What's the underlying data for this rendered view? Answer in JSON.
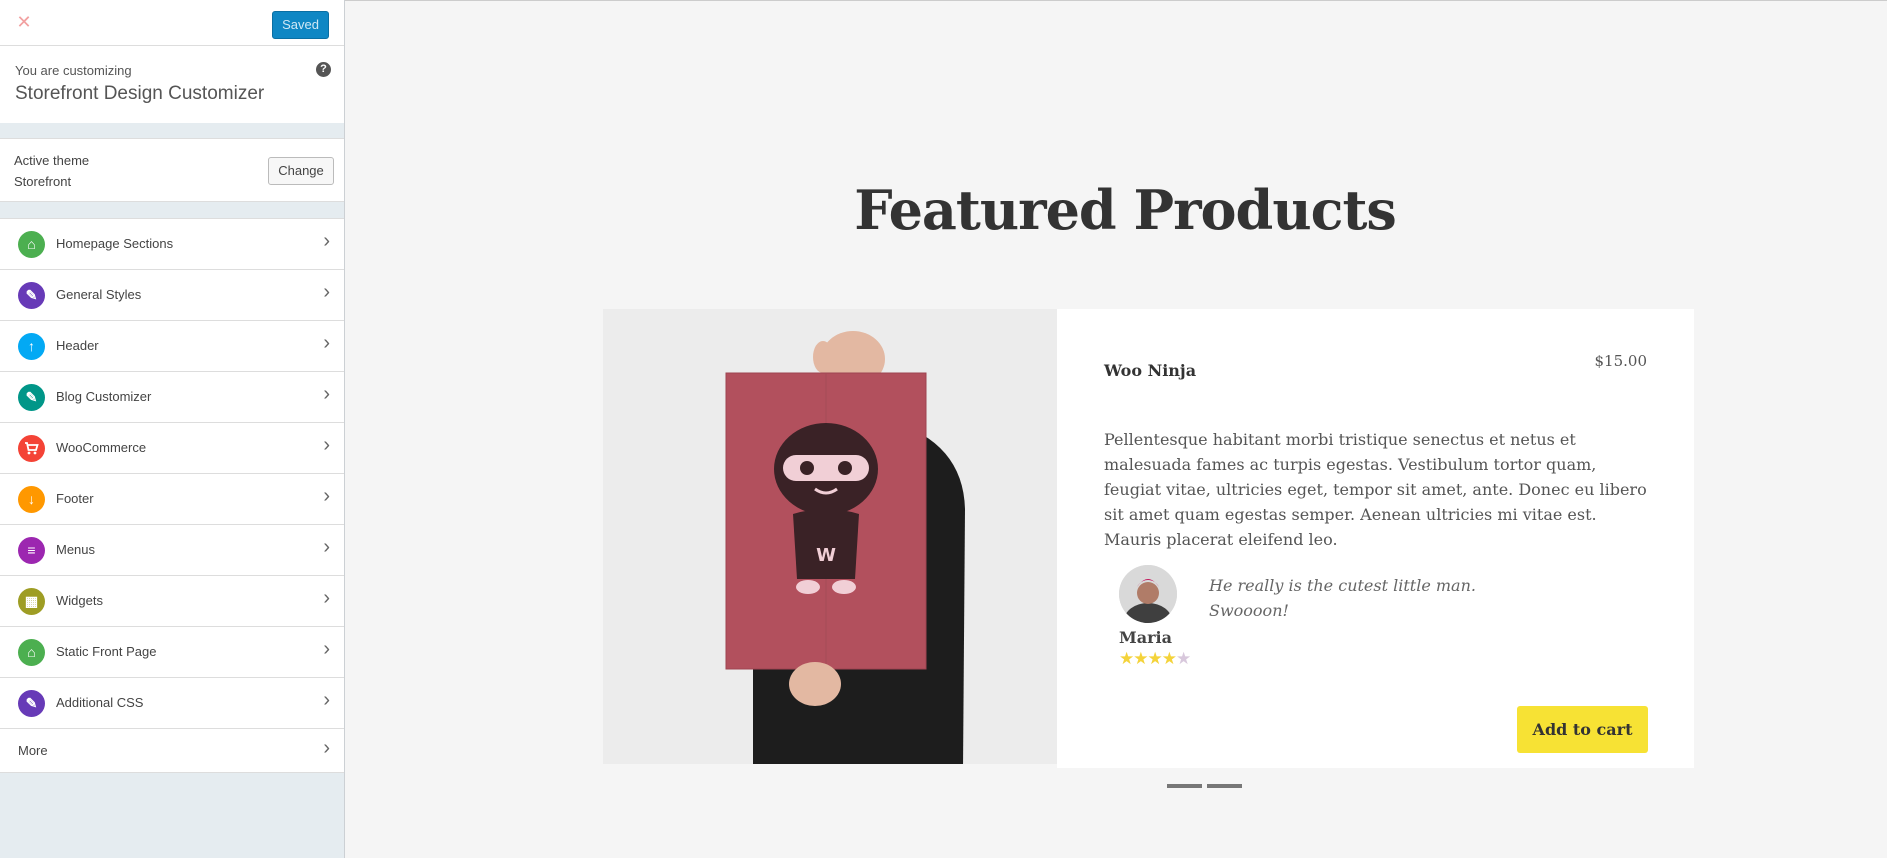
{
  "sidebar": {
    "close_glyph": "✕",
    "saved_label": "Saved",
    "customizing_label": "You are customizing",
    "customizing_title": "Storefront Design Customizer",
    "help_glyph": "?",
    "active_theme_label": "Active theme",
    "active_theme_name": "Storefront",
    "change_label": "Change",
    "items": [
      {
        "label": "Homepage Sections",
        "icon": "home-icon",
        "glyph": "⌂",
        "color": "#4caf50"
      },
      {
        "label": "General Styles",
        "icon": "paintbrush-icon",
        "glyph": "✎",
        "color": "#673ab7"
      },
      {
        "label": "Header",
        "icon": "arrow-up-icon",
        "glyph": "↑",
        "color": "#03a9f4"
      },
      {
        "label": "Blog Customizer",
        "icon": "pencil-icon",
        "glyph": "✎",
        "color": "#009688"
      },
      {
        "label": "WooCommerce",
        "icon": "cart-icon",
        "glyph": "🛒",
        "color": "#f44336"
      },
      {
        "label": "Footer",
        "icon": "arrow-down-icon",
        "glyph": "↓",
        "color": "#ff9800"
      },
      {
        "label": "Menus",
        "icon": "menu-icon",
        "glyph": "≡",
        "color": "#9c27b0"
      },
      {
        "label": "Widgets",
        "icon": "widgets-icon",
        "glyph": "▦",
        "color": "#9e9d24"
      },
      {
        "label": "Static Front Page",
        "icon": "home-icon",
        "glyph": "⌂",
        "color": "#4caf50"
      },
      {
        "label": "Additional CSS",
        "icon": "paintbrush-icon",
        "glyph": "✎",
        "color": "#673ab7"
      }
    ],
    "more_label": "More",
    "chevron_glyph": "›"
  },
  "preview": {
    "heading": "Featured Products",
    "product": {
      "name": "Woo Ninja",
      "price": "$15.00",
      "description": "Pellentesque habitant morbi tristique senectus et netus et malesuada fames ac turpis egestas. Vestibulum tortor quam, feugiat vitae, ultricies eget, tempor sit amet, ante. Donec eu libero sit amet quam egestas semper. Aenean ultricies mi vitae est. Mauris placerat eleifend leo.",
      "poster_letter": "W"
    },
    "review": {
      "name": "Maria",
      "quote": "He really is the cutest little man. Swoooon!",
      "rating": 4,
      "max_rating": 5
    },
    "add_to_cart_label": "Add to cart",
    "slider_pages": 2,
    "colors": {
      "accent_button": "#f7e234",
      "saved_button": "#0f87c4",
      "poster": "#b2505d"
    }
  }
}
